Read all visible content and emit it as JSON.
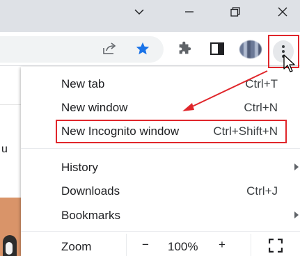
{
  "window": {
    "controls": [
      {
        "name": "minimize",
        "glyph": "chevron-down"
      },
      {
        "name": "minimize-window",
        "glyph": "line"
      },
      {
        "name": "restore",
        "glyph": "restore"
      },
      {
        "name": "close",
        "glyph": "x"
      }
    ]
  },
  "toolbar": {
    "icons": [
      "share-icon",
      "bookmark-star-icon",
      "extensions-puzzle-icon",
      "side-panel-icon",
      "profile-avatar",
      "more-menu-icon"
    ],
    "star_color": "#1a73e8"
  },
  "page": {
    "visible_text": "u"
  },
  "menu": {
    "items": [
      {
        "label": "New tab",
        "shortcut": "Ctrl+T"
      },
      {
        "label": "New window",
        "shortcut": "Ctrl+N"
      },
      {
        "label": "New Incognito window",
        "shortcut": "Ctrl+Shift+N"
      },
      {
        "label": "History",
        "shortcut": ""
      },
      {
        "label": "Downloads",
        "shortcut": "Ctrl+J"
      },
      {
        "label": "Bookmarks",
        "shortcut": ""
      }
    ],
    "zoom": {
      "label": "Zoom",
      "minus": "−",
      "value": "100%",
      "plus": "+"
    }
  },
  "annotation": {
    "color": "#e0262b"
  }
}
